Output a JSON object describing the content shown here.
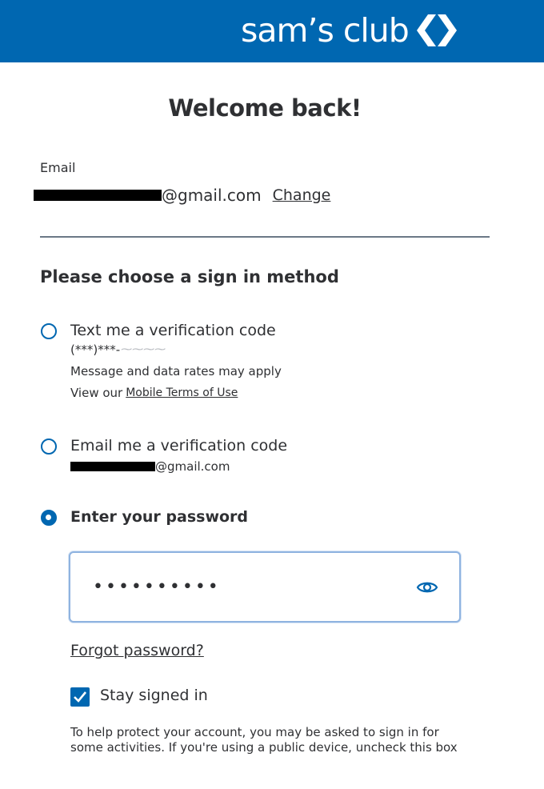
{
  "header": {
    "logo_text": "sam’s club",
    "brand_color": "#0067b1"
  },
  "title": "Welcome back!",
  "email": {
    "label": "Email",
    "value_visible": "@gmail.com",
    "change_label": "Change"
  },
  "method_heading": "Please choose a sign in method",
  "options": [
    {
      "label": "Text me a verification code",
      "detail": "(***)***-",
      "note": "Message and data rates may apply",
      "terms_prefix": "View our",
      "terms_link": "Mobile Terms of Use",
      "selected": false
    },
    {
      "label": "Email me a verification code",
      "detail": "@gmail.com",
      "selected": false
    },
    {
      "label": "Enter your password",
      "selected": true
    }
  ],
  "password": {
    "value": "••••••••••",
    "toggle_icon": "eye-icon"
  },
  "forgot_password": "Forgot password?",
  "stay_signed_in": {
    "label": "Stay signed in",
    "checked": true
  },
  "help_text": "To help protect your account, you may be asked to sign in for some activities. If you're using a public device, uncheck this box"
}
